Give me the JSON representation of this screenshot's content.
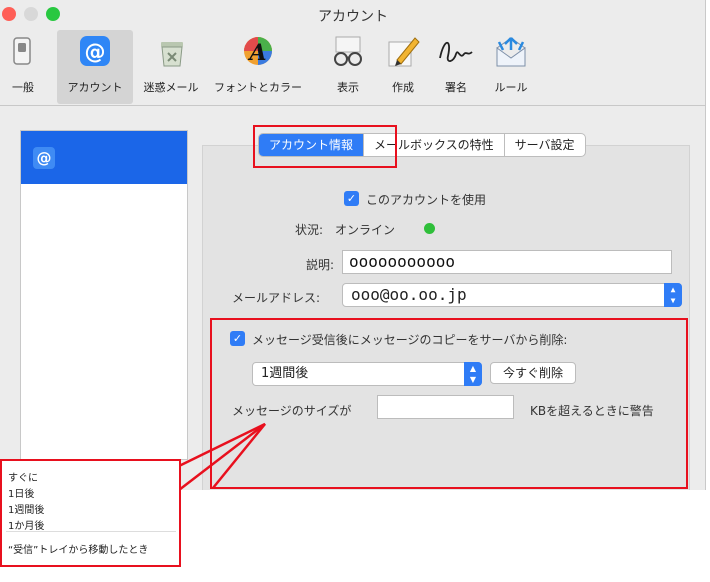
{
  "window": {
    "title": "アカウント"
  },
  "toolbar": {
    "items": [
      {
        "label": "一般"
      },
      {
        "label": "アカウント"
      },
      {
        "label": "迷惑メール"
      },
      {
        "label": "フォントとカラー"
      },
      {
        "label": "表示"
      },
      {
        "label": "作成"
      },
      {
        "label": "署名"
      },
      {
        "label": "ルール"
      }
    ],
    "active": "アカウント"
  },
  "tabs": [
    {
      "label": "アカウント情報",
      "selected": true
    },
    {
      "label": "メールボックスの特性",
      "selected": false
    },
    {
      "label": "サーバ設定",
      "selected": false
    }
  ],
  "account": {
    "use_account_label": "このアカウントを使用",
    "status_label": "状況:",
    "status_value": "オンライン",
    "description_label": "説明:",
    "description_value": "ooooooooooo",
    "email_label": "メールアドレス:",
    "email_value": "ooo@oo.oo.jp"
  },
  "message_options": {
    "delete_copy_label": "メッセージ受信後にメッセージのコピーをサーバから削除:",
    "period_value": "1週間後",
    "delete_now_button": "今すぐ削除",
    "size_prefix": "メッセージのサイズが",
    "size_value": "",
    "size_suffix": "KBを超えるときに警告"
  },
  "popup_menu": {
    "items": [
      "すぐに",
      "1日後",
      "1週間後",
      "1か月後"
    ],
    "extra_item": "“受信”トレイから移動したとき"
  },
  "colors": {
    "accent": "#2f7cf6",
    "selection": "#1b66e8",
    "annotation": "#e8101e",
    "online": "#2fbf3a"
  }
}
